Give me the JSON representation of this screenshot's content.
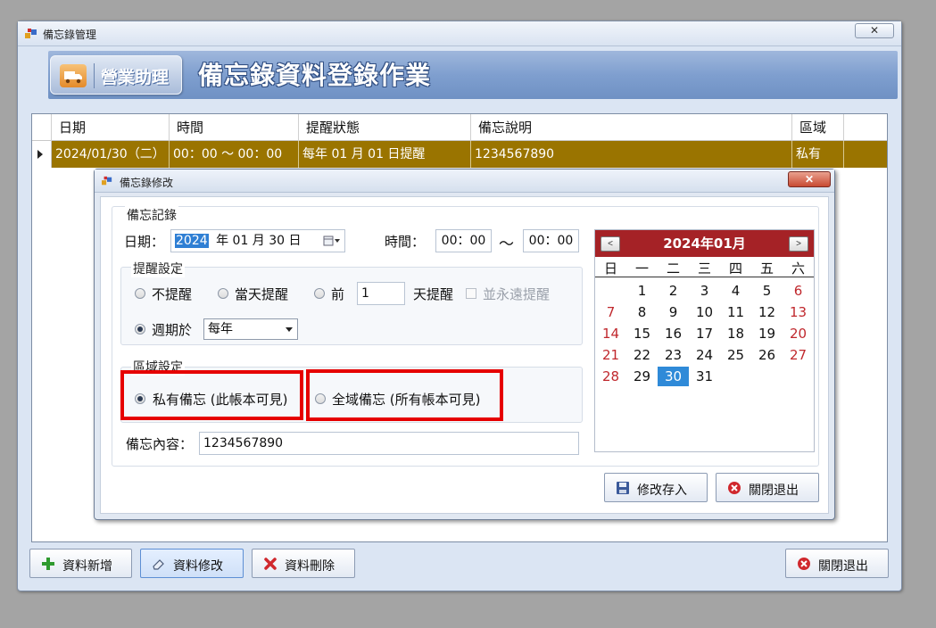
{
  "window": {
    "title": "備忘錄管理",
    "close_glyph": "✕"
  },
  "banner": {
    "logo_text": "營業助理",
    "title": "備忘錄資料登錄作業"
  },
  "grid": {
    "columns": [
      "日期",
      "時間",
      "提醒狀態",
      "備忘說明",
      "區域"
    ],
    "rows": [
      {
        "date": "2024/01/30（二）",
        "time": "00：00 ～ 00：00",
        "reminder": "每年 01 月 01 日提醒",
        "note": "1234567890",
        "area": "私有"
      }
    ]
  },
  "buttons": {
    "add": "資料新增",
    "edit": "資料修改",
    "delete": "資料刪除",
    "exit": "關閉退出"
  },
  "dialog": {
    "title": "備忘錄修改",
    "close_glyph": "✕",
    "section_record": "備忘記錄",
    "date_label": "日期：",
    "date_year": "2024",
    "date_rest": "年 01 月 30 日",
    "time_label": "時間：",
    "time_from": "00：00",
    "time_sep": "～",
    "time_to": "00：00",
    "reminder_group": "提醒設定",
    "reminder_none": "不提醒",
    "reminder_same_day": "當天提醒",
    "reminder_before": "前",
    "reminder_days": "1",
    "reminder_days_suffix": "天提醒",
    "reminder_forever": "並永遠提醒",
    "reminder_cycle": "週期於",
    "cycle_value": "每年",
    "area_group": "區域設定",
    "area_private": "私有備忘 (此帳本可見)",
    "area_global": "全域備忘 (所有帳本可見)",
    "content_label": "備忘內容：",
    "content_value": "1234567890",
    "save": "修改存入",
    "close": "關閉退出"
  },
  "calendar": {
    "title": "2024年01月",
    "prev": "<",
    "next": ">",
    "weekdays": [
      "日",
      "一",
      "二",
      "三",
      "四",
      "五",
      "六"
    ],
    "selected_day": 30,
    "weeks": [
      [
        "",
        "1",
        "2",
        "3",
        "4",
        "5",
        "6"
      ],
      [
        "7",
        "8",
        "9",
        "10",
        "11",
        "12",
        "13"
      ],
      [
        "14",
        "15",
        "16",
        "17",
        "18",
        "19",
        "20"
      ],
      [
        "21",
        "22",
        "23",
        "24",
        "25",
        "26",
        "27"
      ],
      [
        "28",
        "29",
        "30",
        "31",
        "",
        "",
        ""
      ]
    ]
  },
  "colors": {
    "selected_row": "#9a7400",
    "calendar_header": "#a52226",
    "weekend": "#c0282d",
    "selected_day": "#2f8ad8",
    "highlight": "#e60000"
  }
}
